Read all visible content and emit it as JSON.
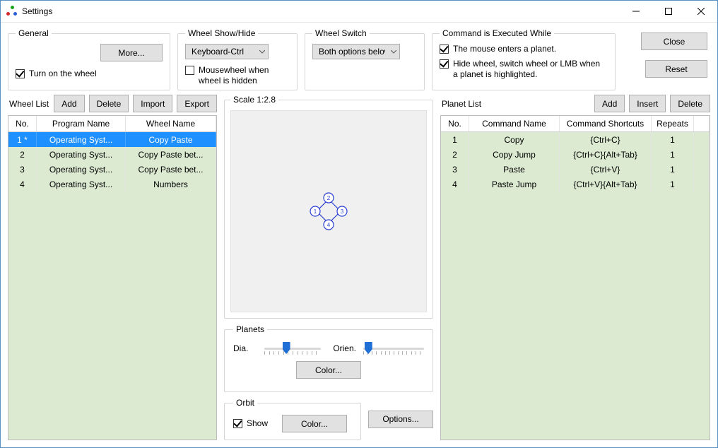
{
  "window": {
    "title": "Settings"
  },
  "titlebar": {
    "min": "Minimize",
    "max": "Maximize",
    "close": "Close"
  },
  "buttons": {
    "close": "Close",
    "reset": "Reset",
    "more": "More...",
    "add": "Add",
    "delete": "Delete",
    "import": "Import",
    "export": "Export",
    "insert": "Insert",
    "color": "Color...",
    "options": "Options..."
  },
  "general": {
    "legend": "General",
    "turn_on": "Turn on the wheel",
    "turn_on_checked": true
  },
  "showhide": {
    "legend": "Wheel Show/Hide",
    "select_value": "Keyboard-Ctrl",
    "mousewheel_label": "Mousewheel when wheel is hidden",
    "mousewheel_checked": false
  },
  "switch": {
    "legend": "Wheel Switch",
    "select_value": "Both options below"
  },
  "exec": {
    "legend": "Command is Executed While",
    "opt1": "The mouse enters a planet.",
    "opt1_checked": true,
    "opt2": "Hide wheel, switch wheel or LMB when a planet is highlighted.",
    "opt2_checked": true
  },
  "wheel_list": {
    "label": "Wheel List",
    "columns": [
      "No.",
      "Program Name",
      "Wheel Name"
    ],
    "rows": [
      {
        "no": "1 *",
        "program": "Operating Syst...",
        "wheel": "Copy Paste",
        "selected": true
      },
      {
        "no": "2",
        "program": "Operating Syst...",
        "wheel": "Copy Paste bet..."
      },
      {
        "no": "3",
        "program": "Operating Syst...",
        "wheel": "Copy Paste bet..."
      },
      {
        "no": "4",
        "program": "Operating Syst...",
        "wheel": "Numbers"
      }
    ]
  },
  "scale": {
    "legend": "Scale 1:2.8"
  },
  "planets_panel": {
    "legend": "Planets",
    "dia_label": "Dia.",
    "orien_label": "Orien.",
    "dia_pos": 0.32,
    "orien_pos": 0.02
  },
  "orbit": {
    "legend": "Orbit",
    "show_label": "Show",
    "show_checked": true
  },
  "planet_list": {
    "label": "Planet List",
    "columns": [
      "No.",
      "Command Name",
      "Command Shortcuts",
      "Repeats"
    ],
    "rows": [
      {
        "no": "1",
        "name": "Copy",
        "shortcut": "{Ctrl+C}",
        "repeats": "1"
      },
      {
        "no": "2",
        "name": "Copy Jump",
        "shortcut": "{Ctrl+C}{Alt+Tab}",
        "repeats": "1"
      },
      {
        "no": "3",
        "name": "Paste",
        "shortcut": "{Ctrl+V}",
        "repeats": "1"
      },
      {
        "no": "4",
        "name": "Paste Jump",
        "shortcut": "{Ctrl+V}{Alt+Tab}",
        "repeats": "1"
      }
    ]
  },
  "wheel_nodes": [
    "1",
    "2",
    "3",
    "4"
  ]
}
